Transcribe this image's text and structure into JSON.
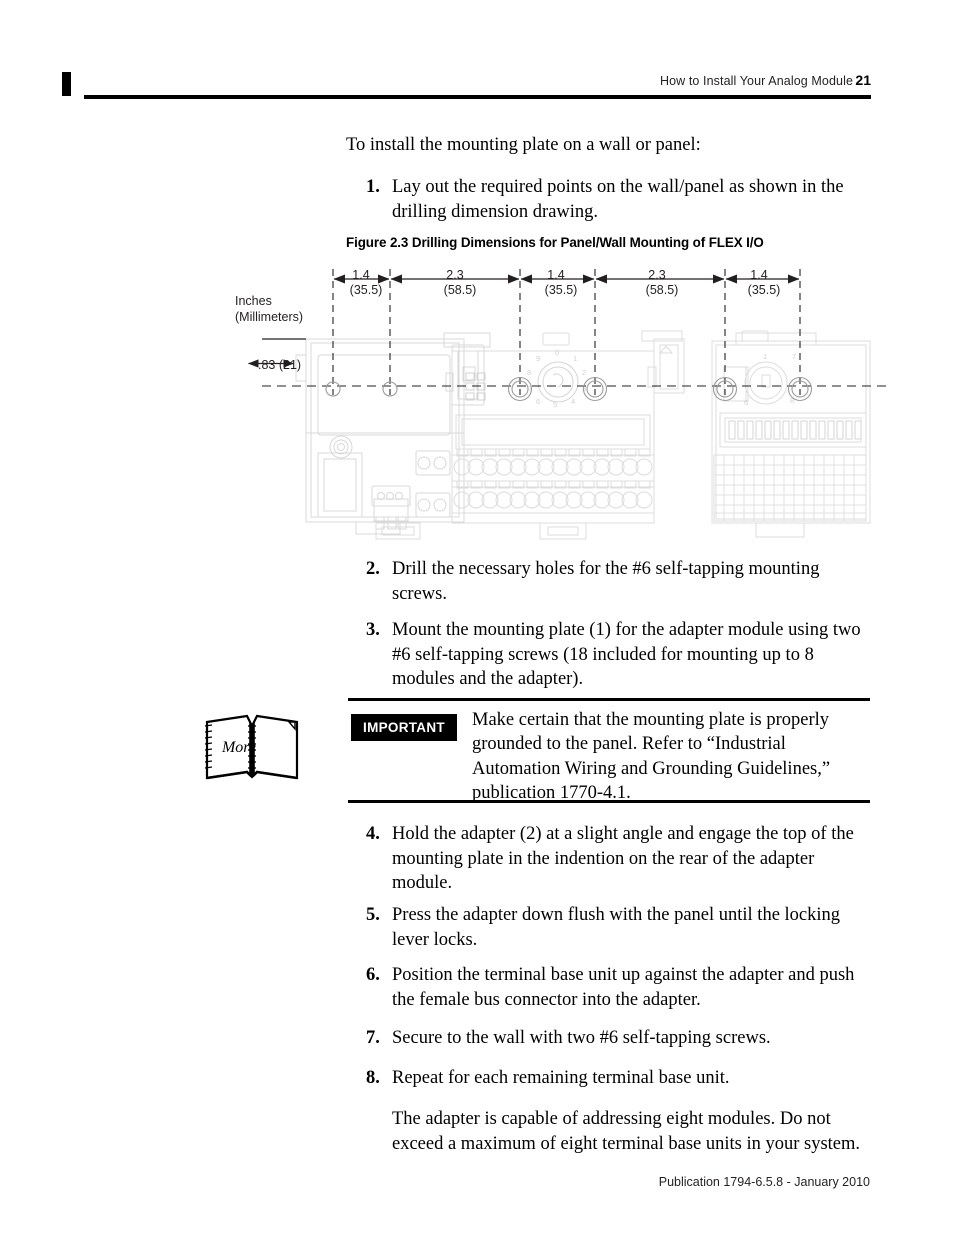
{
  "header": {
    "title": "How to Install Your Analog Module",
    "page_number": "21"
  },
  "body": {
    "intro": "To install the mounting plate on a wall or panel:",
    "steps": [
      {
        "num": "1.",
        "text": "Lay out the required points on the wall/panel as shown in the drilling dimension drawing."
      },
      {
        "num": "2.",
        "text": "Drill the necessary holes for the #6 self-tapping mounting screws."
      },
      {
        "num": "3.",
        "text": "Mount the mounting plate (1) for the adapter module using two #6 self-tapping screws (18 included for mounting up to 8 modules and the adapter)."
      },
      {
        "num": "4.",
        "text": "Hold the adapter (2) at a slight angle and engage the top of the mounting plate in the indention on the rear of the adapter module."
      },
      {
        "num": "5.",
        "text": "Press the adapter down flush with the panel until the locking lever locks."
      },
      {
        "num": "6.",
        "text": "Position the terminal base unit up against the adapter and push the female bus connector into the adapter."
      },
      {
        "num": "7.",
        "text": "Secure to the wall with two #6 self-tapping screws."
      },
      {
        "num": "8.",
        "text": "Repeat for each remaining terminal base unit."
      }
    ],
    "closing": "The adapter is capable of addressing eight modules. Do not exceed a maximum of eight terminal base units in your system."
  },
  "figure": {
    "caption": "Figure 2.3 Drilling Dimensions for Panel/Wall Mounting of FLEX I/O",
    "units_label_line1": "Inches",
    "units_label_line2": "(Millimeters)",
    "horizontal_dimensions": [
      {
        "inches": "1.4",
        "mm": "(35.5)"
      },
      {
        "inches": "2.3",
        "mm": "(58.5)"
      },
      {
        "inches": "1.4",
        "mm": "(35.5)"
      },
      {
        "inches": "2.3",
        "mm": "(58.5)"
      },
      {
        "inches": "1.4",
        "mm": "(35.5)"
      }
    ],
    "vertical_dimension": ".83 (21)",
    "switch_digits": [
      "0",
      "1",
      "2",
      "3",
      "4",
      "5",
      "6",
      "7",
      "8",
      "9"
    ]
  },
  "important": {
    "badge": "IMPORTANT",
    "text": "Make certain that the mounting plate is properly grounded to the panel. Refer to “Industrial Automation Wiring and Grounding Guidelines,” publication 1770-4.1.",
    "icon_label": "More"
  },
  "footer": {
    "publication": "Publication 1794-6.5.8 - January 2010"
  }
}
